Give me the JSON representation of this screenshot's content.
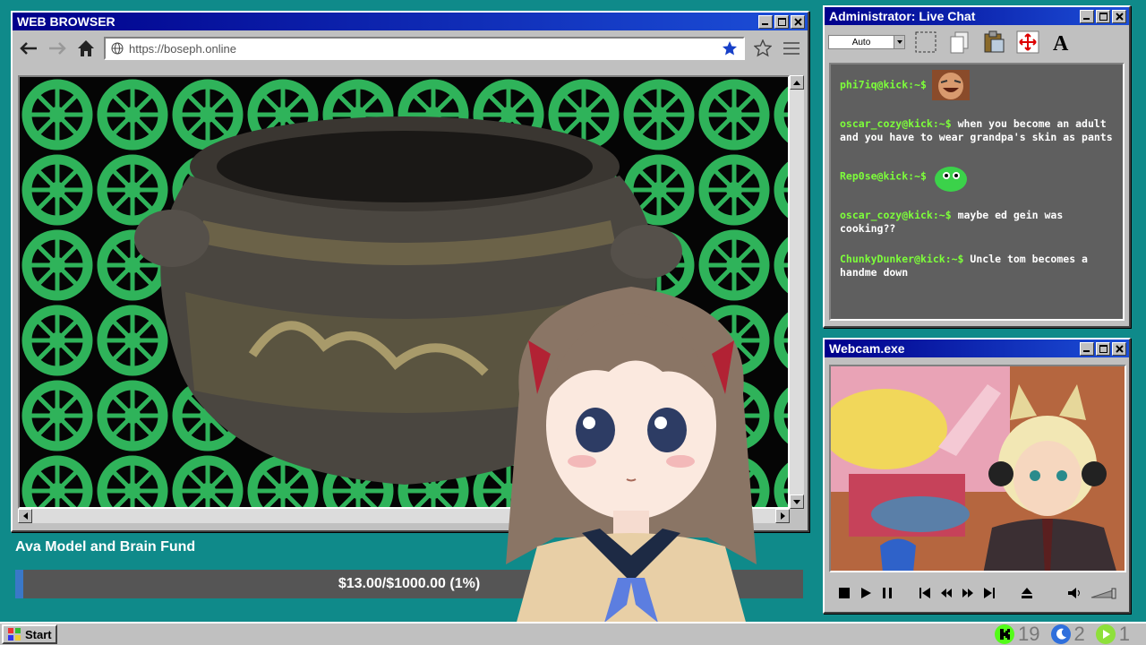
{
  "browser": {
    "title": "WEB BROWSER",
    "url": "https://boseph.online"
  },
  "chat": {
    "title": "Administrator: Live Chat",
    "font_size_select": "Auto",
    "messages": [
      {
        "user": "phi7iq@kick:~$",
        "text": "",
        "emote": "laughing-man-emote"
      },
      {
        "user": "oscar_cozy@kick:~$",
        "text": "when you become an adult and you have to wear grandpa's skin as pants",
        "emote": ""
      },
      {
        "user": "Rep0se@kick:~$",
        "text": "",
        "emote": "green-blob-emote"
      },
      {
        "user": "oscar_cozy@kick:~$",
        "text": "maybe ed gein was cooking??",
        "emote": ""
      },
      {
        "user": "ChunkyDunker@kick:~$",
        "text": "Uncle tom becomes a handme down",
        "emote": ""
      }
    ]
  },
  "webcam": {
    "title": "Webcam.exe"
  },
  "fund": {
    "title": "Ava Model and Brain Fund",
    "progress_text": "$13.00/$1000.00 (1%)",
    "raised": 13.0,
    "goal": 1000.0,
    "percent": 1
  },
  "taskbar": {
    "start_label": "Start",
    "stats": [
      {
        "icon": "kick-icon",
        "value": "19",
        "color": "#53fc18"
      },
      {
        "icon": "moon-icon",
        "value": "2",
        "color": "#2f6fdc"
      },
      {
        "icon": "play-icon",
        "value": "1",
        "color": "#8ee03a"
      }
    ]
  },
  "colors": {
    "desktop": "#0f8a8a",
    "titlebar": "#00008b",
    "chat_user": "#7dff3a"
  }
}
